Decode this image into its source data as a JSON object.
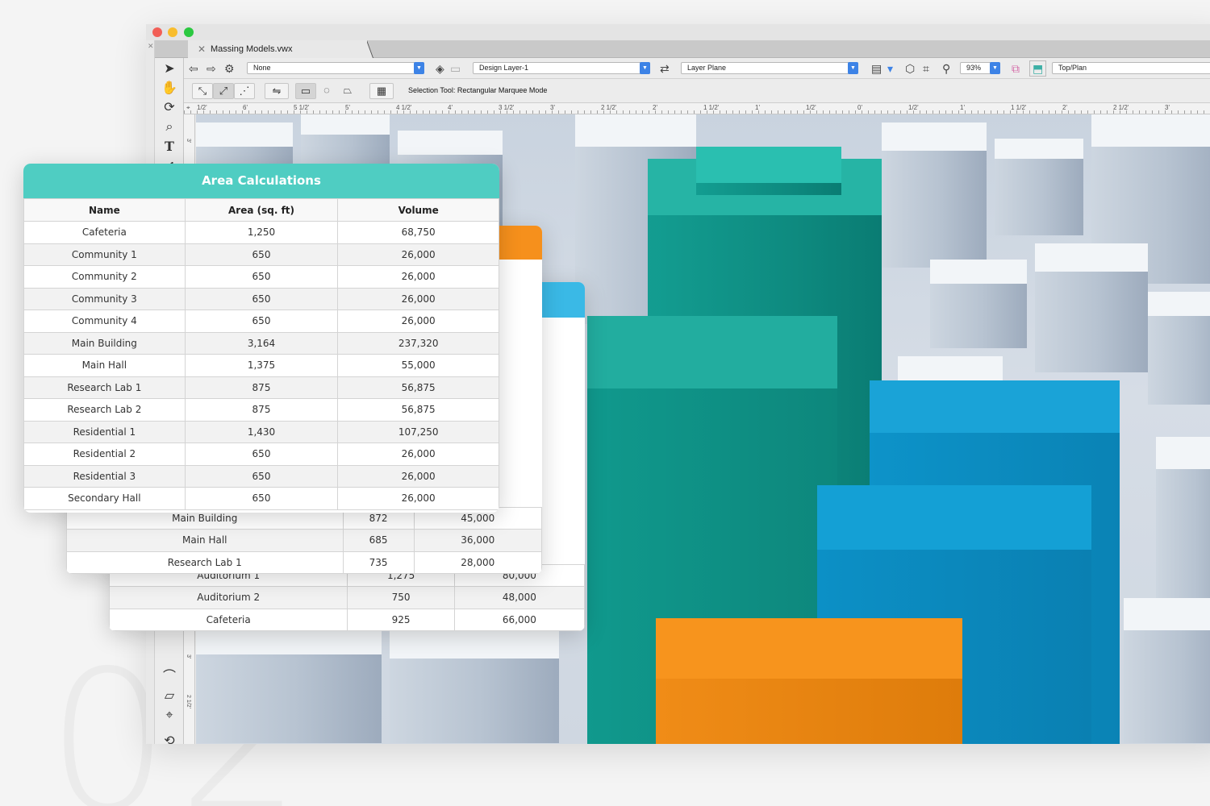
{
  "decor": {
    "section_number": "02"
  },
  "app": {
    "document_tab": "Massing Models.vwx",
    "toolbar": {
      "class_dropdown": "None",
      "layer_dropdown": "Design Layer-1",
      "plane_dropdown": "Layer Plane",
      "zoom": "93%",
      "view_dropdown": "Top/Plan"
    },
    "tool_status": "Selection Tool: Rectangular Marquee Mode",
    "ruler_labels": [
      "1/2'",
      "6'",
      "5 1/2'",
      "5'",
      "4 1/2'",
      "4'",
      "3 1/2'",
      "3'",
      "2 1/2'",
      "2'",
      "1 1/2'",
      "1'",
      "1/2'",
      "0'",
      "1/2'",
      "1'",
      "1 1/2'",
      "2'",
      "2 1/2'",
      "3'"
    ],
    "vertical_ruler_labels": [
      "3'",
      "3'",
      "2 1/2'"
    ]
  },
  "area_table": {
    "title": "Area Calculations",
    "columns": [
      "Name",
      "Area (sq. ft)",
      "Volume"
    ],
    "rows": [
      [
        "Cafeteria",
        "1,250",
        "68,750"
      ],
      [
        "Community 1",
        "650",
        "26,000"
      ],
      [
        "Community 2",
        "650",
        "26,000"
      ],
      [
        "Community 3",
        "650",
        "26,000"
      ],
      [
        "Community 4",
        "650",
        "26,000"
      ],
      [
        "Main Building",
        "3,164",
        "237,320"
      ],
      [
        "Main Hall",
        "1,375",
        "55,000"
      ],
      [
        "Research Lab 1",
        "875",
        "56,875"
      ],
      [
        "Research Lab 2",
        "875",
        "56,875"
      ],
      [
        "Residential 1",
        "1,430",
        "107,250"
      ],
      [
        "Residential 2",
        "650",
        "26,000"
      ],
      [
        "Residential 3",
        "650",
        "26,000"
      ],
      [
        "Secondary Hall",
        "650",
        "26,000"
      ]
    ]
  },
  "orange_table_visible_rows": [
    [
      "Main Building",
      "872",
      "45,000"
    ],
    [
      "Main Hall",
      "685",
      "36,000"
    ],
    [
      "Research Lab 1",
      "735",
      "28,000"
    ]
  ],
  "blue_table_visible_rows": [
    [
      "Auditorium 1",
      "1,275",
      "80,000"
    ],
    [
      "Auditorium 2",
      "750",
      "48,000"
    ],
    [
      "Cafeteria",
      "925",
      "66,000"
    ]
  ],
  "colors": {
    "teal_header": "#4fcdc2",
    "orange_header": "#f6901c",
    "blue_header": "#3ab9e6",
    "teal_building": "#139d91",
    "blue_building": "#0d93c9",
    "orange_building": "#f08c17"
  }
}
